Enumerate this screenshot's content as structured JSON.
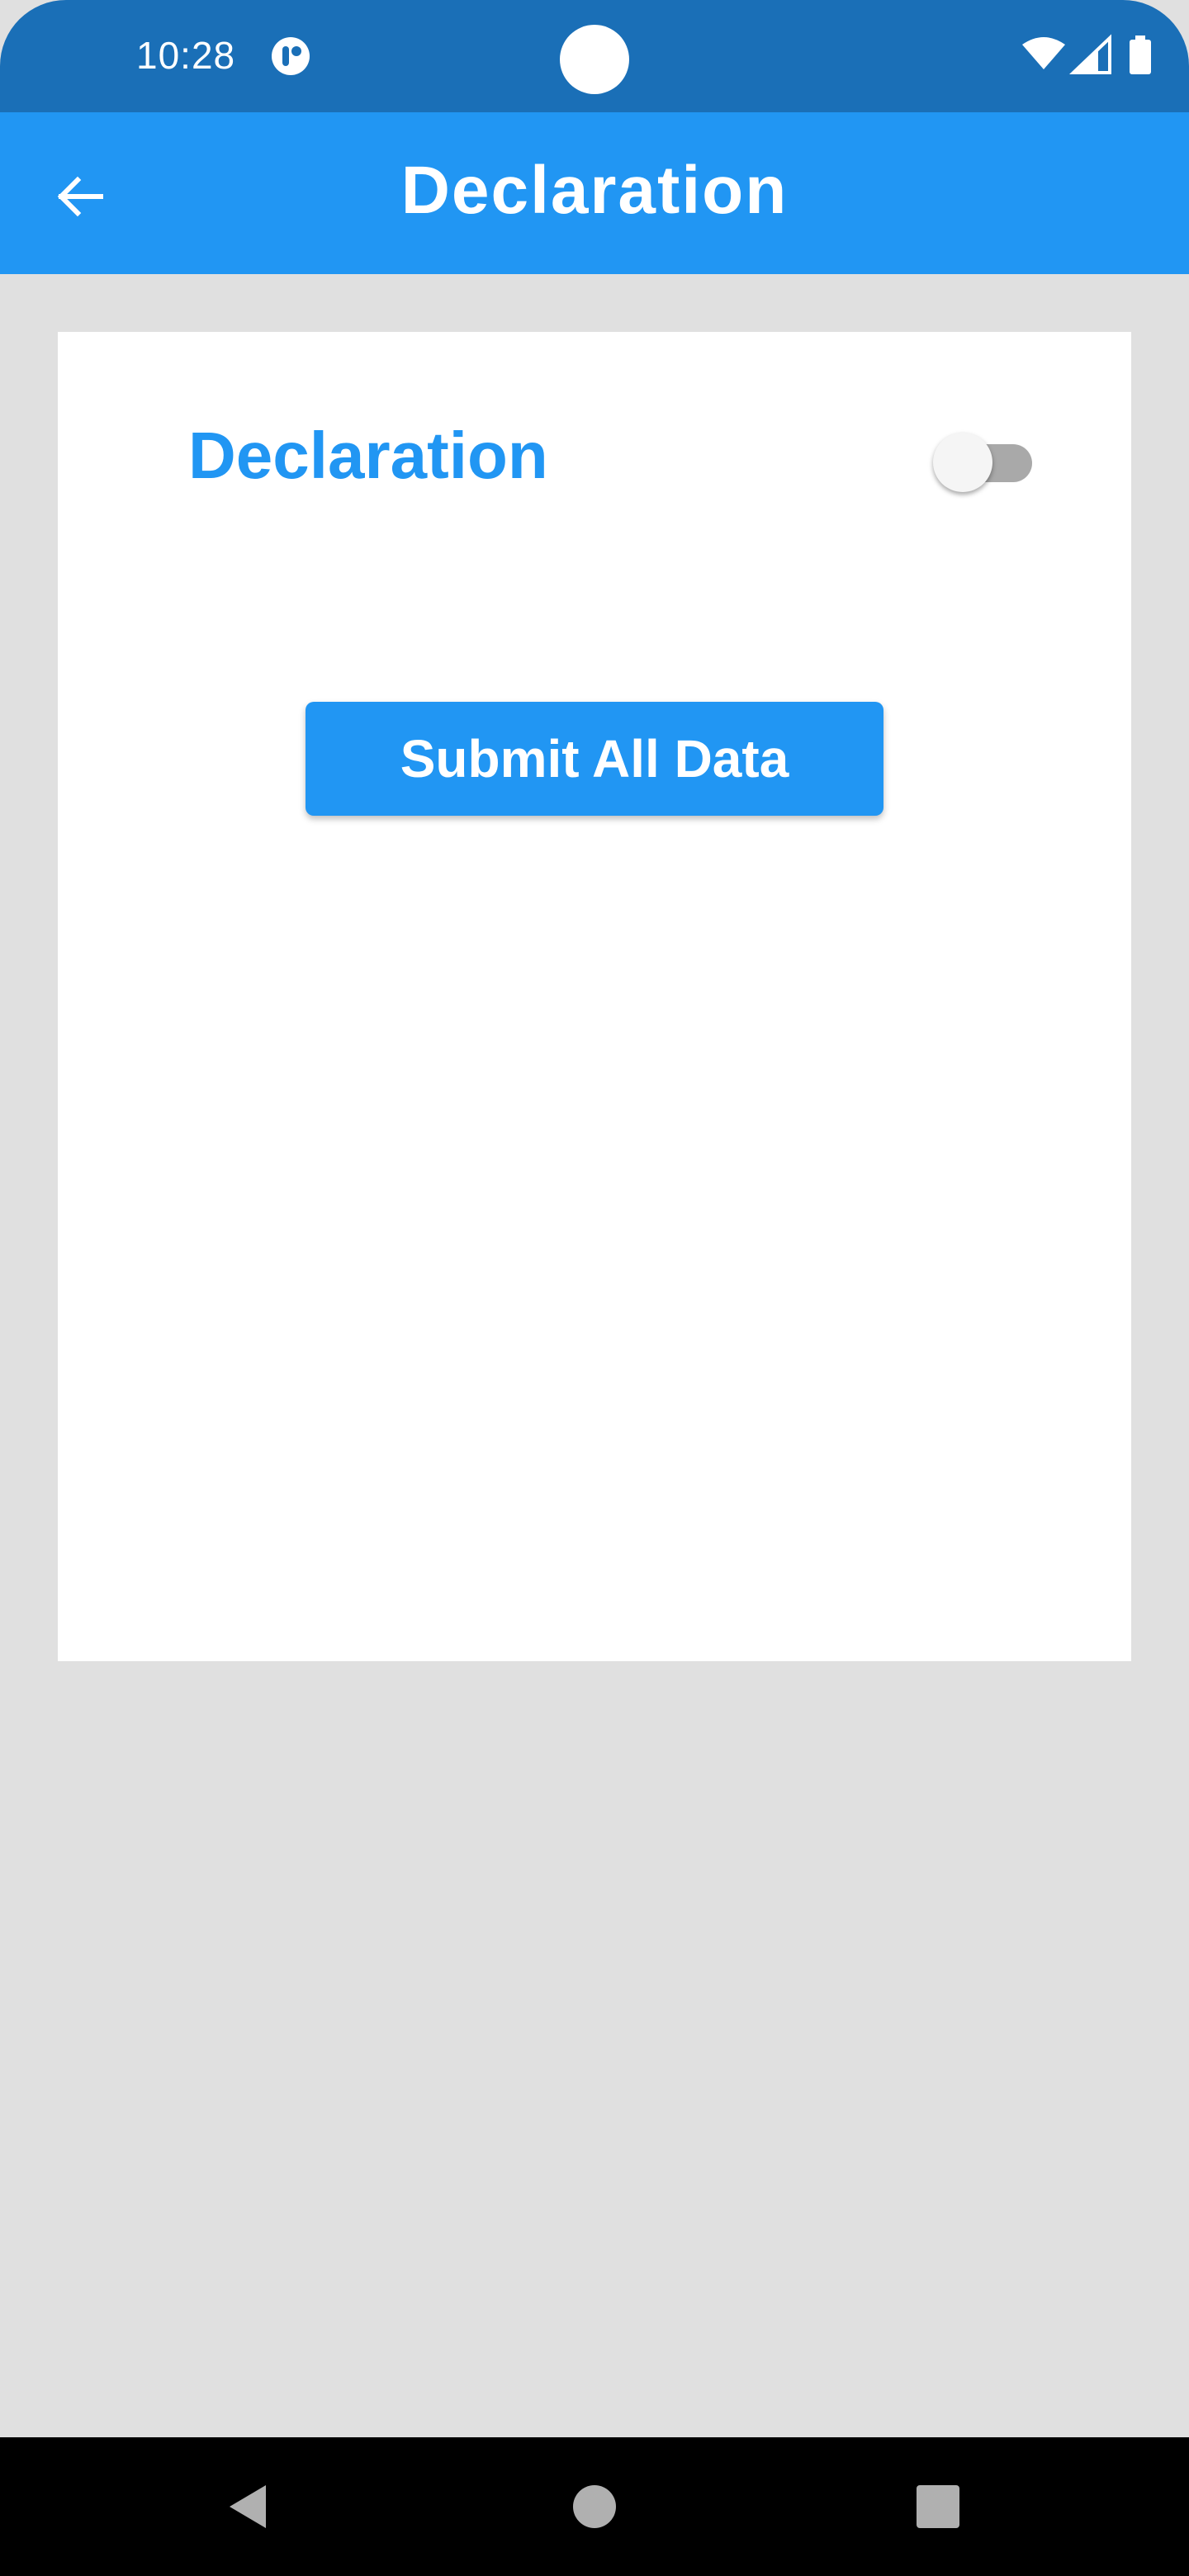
{
  "status_bar": {
    "time": "10:28",
    "icons": [
      "app-indicator-icon",
      "wifi-icon",
      "signal-icon",
      "battery-icon"
    ]
  },
  "app_bar": {
    "title": "Declaration",
    "back_icon": "arrow-left-icon"
  },
  "card": {
    "declaration_label": "Declaration",
    "declaration_toggle_on": false,
    "submit_label": "Submit All Data"
  },
  "nav_bar": {
    "buttons": [
      "back-triangle-icon",
      "home-circle-icon",
      "recents-square-icon"
    ]
  },
  "colors": {
    "primary": "#2196f3",
    "status_bar": "#1a6fb7",
    "background": "#e0e0e0"
  }
}
